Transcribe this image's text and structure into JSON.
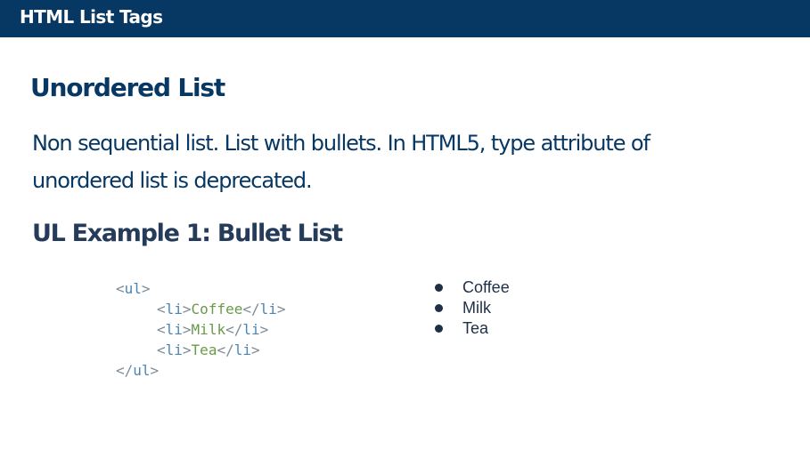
{
  "header": {
    "title": "HTML List Tags"
  },
  "section": {
    "title": "Unordered List",
    "description_line1": "Non sequential list. List with bullets. In HTML5, type attribute of",
    "description_line2": "unordered list is deprecated."
  },
  "example": {
    "title": "UL Example 1: Bullet List",
    "code": {
      "open_ul": "ul",
      "close_ul": "ul",
      "li_tag": "li",
      "items": [
        "Coffee",
        "Milk",
        "Tea"
      ]
    },
    "rendered_items": [
      "Coffee",
      "Milk",
      "Tea"
    ]
  },
  "colors": {
    "header_bg": "#073763",
    "title": "#073763",
    "code_tag": "#4a86b5",
    "code_text": "#6a9a4a"
  }
}
